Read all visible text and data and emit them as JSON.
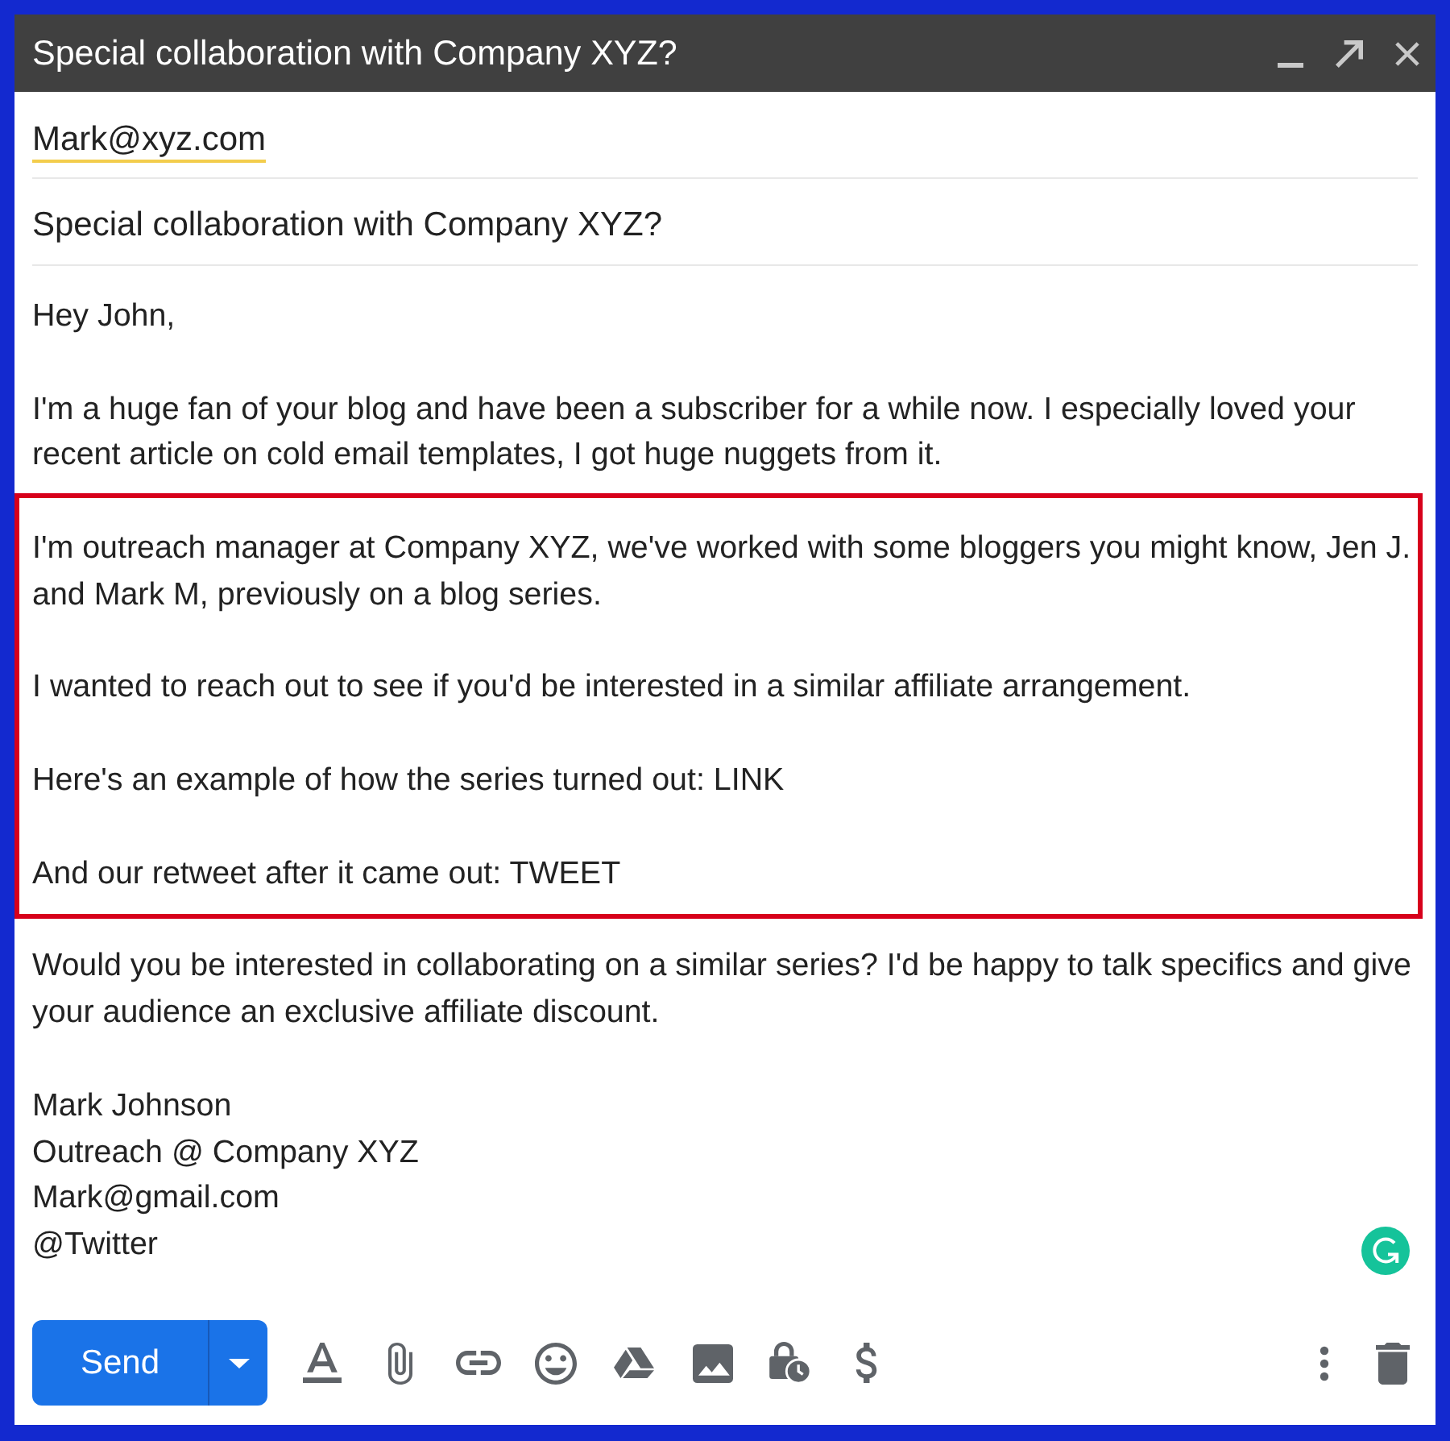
{
  "window": {
    "title": "Special collaboration with Company XYZ?"
  },
  "recipient": {
    "value": "Mark@xyz.com"
  },
  "subject": {
    "value": "Special collaboration with Company XYZ?"
  },
  "body": {
    "paragraphs": [
      {
        "lines": [
          "Hey John,"
        ],
        "highlighted": false
      },
      {
        "lines": [
          "I'm a huge fan of your blog and have been a subscriber for a while now. I especially loved your",
          "recent article on cold email templates, I got huge nuggets from it."
        ],
        "highlighted": false
      },
      {
        "lines": [
          "I'm outreach manager at Company XYZ, we've worked with some bloggers you might know, Jen J.",
          "and Mark M, previously on a blog series."
        ],
        "highlighted": true
      },
      {
        "lines": [
          "I wanted to reach out to see if you'd be interested in a similar affiliate arrangement."
        ],
        "highlighted": true
      },
      {
        "lines": [
          "Here's an example of how the series turned out: LINK"
        ],
        "highlighted": true
      },
      {
        "lines": [
          "And our retweet after it came out: TWEET"
        ],
        "highlighted": true
      },
      {
        "lines": [
          "Would you be interested in collaborating on a similar series? I'd be happy to talk specifics and give",
          "your audience an exclusive affiliate discount."
        ],
        "highlighted": false
      }
    ],
    "signature": [
      "Mark Johnson",
      "Outreach @ Company XYZ",
      "Mark@gmail.com",
      "@Twitter"
    ]
  },
  "toolbar": {
    "send_button": "Send"
  }
}
